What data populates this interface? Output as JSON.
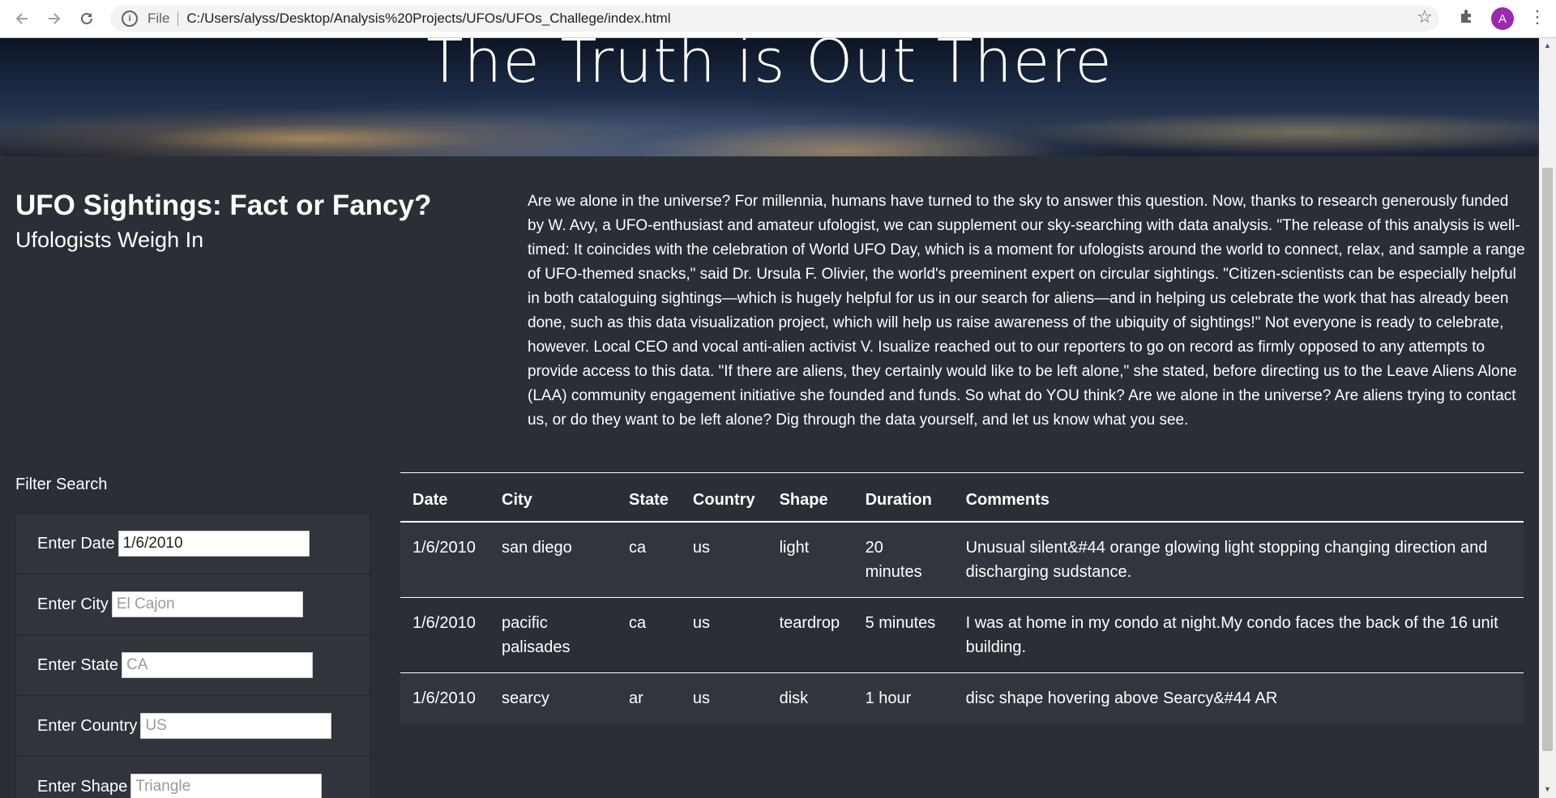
{
  "browser": {
    "file_label": "File",
    "url": "C:/Users/alyss/Desktop/Analysis%20Projects/UFOs/UFOs_Challege/index.html",
    "avatar_letter": "A",
    "icons": [
      "back-arrow-icon",
      "forward-arrow-icon",
      "reload-icon",
      "info-icon",
      "star-icon",
      "puzzle-icon",
      "kebab-menu-icon"
    ],
    "avatar_color": "#9c27b0"
  },
  "hero": {
    "title": "The Truth is Out There"
  },
  "header": {
    "title": "UFO Sightings: Fact or Fancy?",
    "subtitle": "Ufologists Weigh In"
  },
  "article": {
    "text": "Are we alone in the universe? For millennia, humans have turned to the sky to answer this question. Now, thanks to research generously funded by W. Avy, a UFO-enthusiast and amateur ufologist, we can supplement our sky-searching with data analysis. \"The release of this analysis is well-timed: It coincides with the celebration of World UFO Day, which is a moment for ufologists around the world to connect, relax, and sample a range of UFO-themed snacks,\" said Dr. Ursula F. Olivier, the world's preeminent expert on circular sightings. \"Citizen-scientists can be especially helpful in both cataloguing sightings—which is hugely helpful for us in our search for aliens—and in helping us celebrate the work that has already been done, such as this data visualization project, which will help us raise awareness of the ubiquity of sightings!\" Not everyone is ready to celebrate, however. Local CEO and vocal anti-alien activist V. Isualize reached out to our reporters to go on record as firmly opposed to any attempts to provide access to this data. \"If there are aliens, they certainly would like to be left alone,\" she stated, before directing us to the Leave Aliens Alone (LAA) community engagement initiative she founded and funds. So what do YOU think? Are we alone in the universe? Are aliens trying to contact us, or do they want to be left alone? Dig through the data yourself, and let us know what you see."
  },
  "filters": {
    "heading": "Filter Search",
    "date": {
      "label": "Enter Date",
      "value": "1/6/2010",
      "placeholder": ""
    },
    "city": {
      "label": "Enter City",
      "value": "",
      "placeholder": "El Cajon"
    },
    "state": {
      "label": "Enter State",
      "value": "",
      "placeholder": "CA"
    },
    "country": {
      "label": "Enter Country",
      "value": "",
      "placeholder": "US"
    },
    "shape": {
      "label": "Enter Shape",
      "value": "",
      "placeholder": "Triangle"
    }
  },
  "table": {
    "headers": [
      "Date",
      "City",
      "State",
      "Country",
      "Shape",
      "Duration",
      "Comments"
    ],
    "rows": [
      [
        "1/6/2010",
        "san diego",
        "ca",
        "us",
        "light",
        "20 minutes",
        "Unusual silent&#44 orange glowing light stopping changing direction and discharging sudstance."
      ],
      [
        "1/6/2010",
        "pacific palisades",
        "ca",
        "us",
        "teardrop",
        "5 minutes",
        "I was at home in my condo at night.My condo faces the back of the 16 unit building."
      ],
      [
        "1/6/2010",
        "searcy",
        "ar",
        "us",
        "disk",
        "1 hour",
        "disc shape hovering above Searcy&#44 AR"
      ]
    ]
  }
}
